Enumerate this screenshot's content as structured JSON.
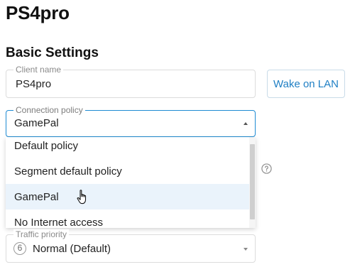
{
  "page": {
    "title": "PS4pro"
  },
  "section": {
    "title": "Basic Settings"
  },
  "client_name": {
    "label": "Client name",
    "value": "PS4pro"
  },
  "wol_button": {
    "label": "Wake on LAN"
  },
  "connection_policy": {
    "label": "Connection policy",
    "value": "GamePal",
    "options": [
      "Default policy",
      "Segment default policy",
      "GamePal",
      "No Internet access"
    ],
    "hovered_option": "GamePal"
  },
  "traffic_priority": {
    "label": "Traffic priority",
    "badge": "6",
    "value": "Normal (Default)"
  },
  "icons": {
    "help": "help-circle-icon",
    "dropdown_caret_up": "caret-up-icon",
    "dropdown_caret_down": "caret-down-icon",
    "cursor": "hand-pointer-cursor"
  },
  "colors": {
    "accent": "#1f8bd3",
    "button_text": "#1f7fc4",
    "hover_bg": "#eaf3fb"
  }
}
